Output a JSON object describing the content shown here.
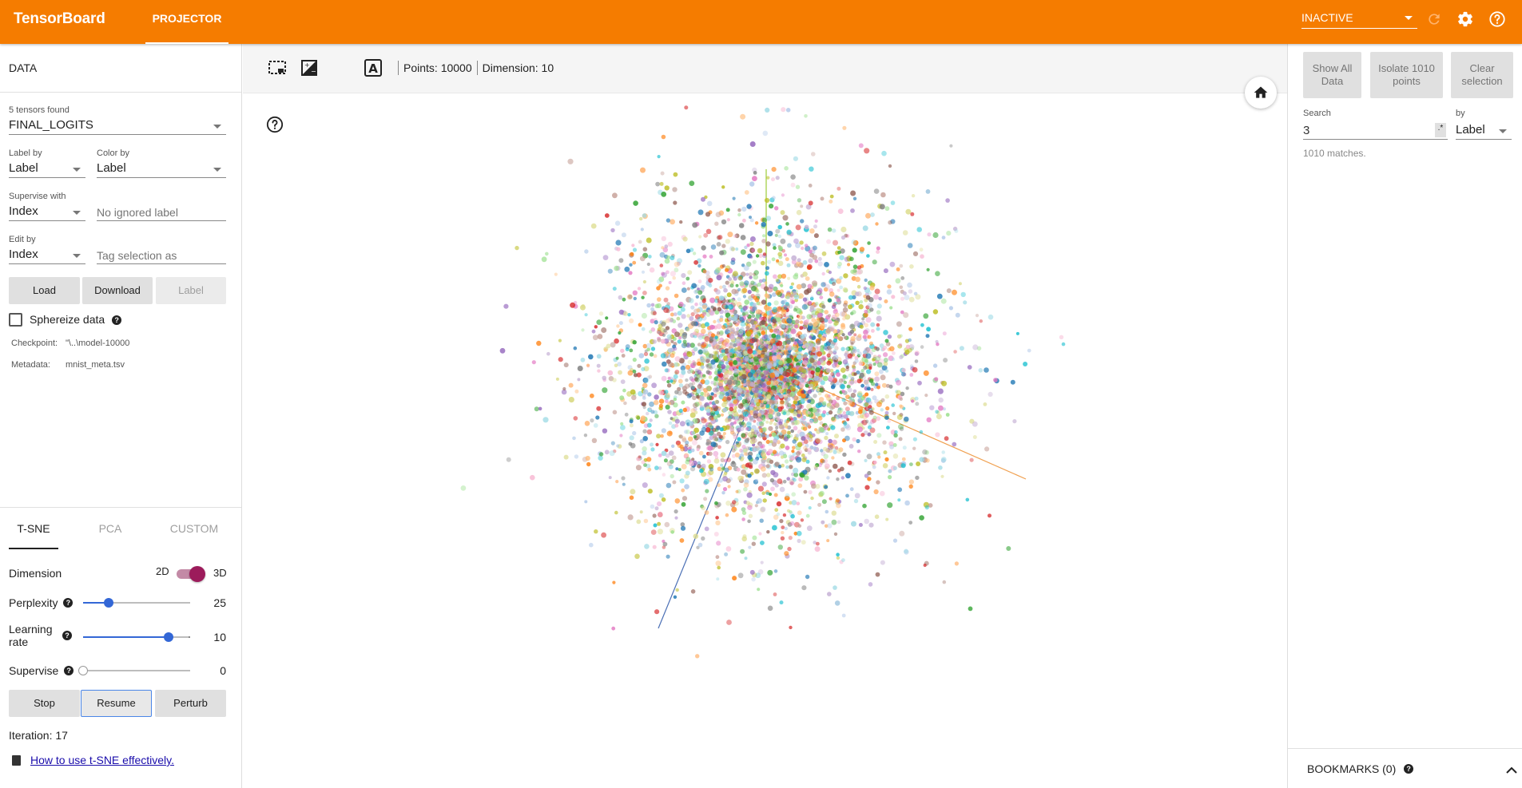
{
  "header": {
    "brand": "TensorBoard",
    "tab_label": "PROJECTOR",
    "runs_status": "INACTIVE",
    "icons": [
      "refresh-icon",
      "settings-icon",
      "help-icon"
    ]
  },
  "data_panel": {
    "title": "DATA",
    "tensors_found": "5 tensors found",
    "tensor_selected": "FINAL_LOGITS",
    "label_by_label": "Label by",
    "label_by_value": "Label",
    "color_by_label": "Color by",
    "color_by_value": "Label",
    "supervise_with_label": "Supervise with",
    "supervise_with_value": "Index",
    "ignored_label_placeholder": "No ignored label",
    "edit_by_label": "Edit by",
    "edit_by_value": "Index",
    "tag_selection_placeholder": "Tag selection as",
    "buttons": {
      "load": "Load",
      "download": "Download",
      "label": "Label"
    },
    "sphereize_label": "Sphereize data",
    "checkpoint_label": "Checkpoint:",
    "checkpoint_value": "\"\\..\\model-10000",
    "metadata_label": "Metadata:",
    "metadata_value": "mnist_meta.tsv"
  },
  "projections": {
    "tabs": [
      "T-SNE",
      "PCA",
      "CUSTOM"
    ],
    "active_tab": "T-SNE",
    "dimension_label": "Dimension",
    "dim_2d": "2D",
    "dim_3d": "3D",
    "dimension_is_3d": true,
    "perplexity_label": "Perplexity",
    "perplexity_value": "25",
    "perplexity_fraction": 0.24,
    "learning_rate_label_1": "Learning",
    "learning_rate_label_2": "rate",
    "learning_rate_value": "10",
    "learning_rate_fraction": 0.8,
    "supervise_label": "Supervise",
    "supervise_value": "0",
    "supervise_fraction": 0,
    "buttons": {
      "stop": "Stop",
      "resume": "Resume",
      "perturb": "Perturb"
    },
    "iteration": "Iteration: 17",
    "help_link": "How to use t-SNE effectively."
  },
  "toolbar": {
    "icons": [
      "select-icon",
      "night-mode-icon",
      "brightness-icon",
      "labels-icon"
    ],
    "points": "Points: 10000",
    "dimension": "Dimension: 10"
  },
  "inspector": {
    "show_all": "Show All Data",
    "isolate": "Isolate 1010 points",
    "clear": "Clear selection",
    "search_label": "Search",
    "search_value": "3",
    "regex_label": ".*",
    "by_label": "by",
    "by_value": "Label",
    "matches": "1010 matches.",
    "bookmarks": "BOOKMARKS (0)"
  },
  "colors": {
    "accent": "#f57c00",
    "slider": "#3367d6",
    "toggle": "#9c1b5b"
  }
}
